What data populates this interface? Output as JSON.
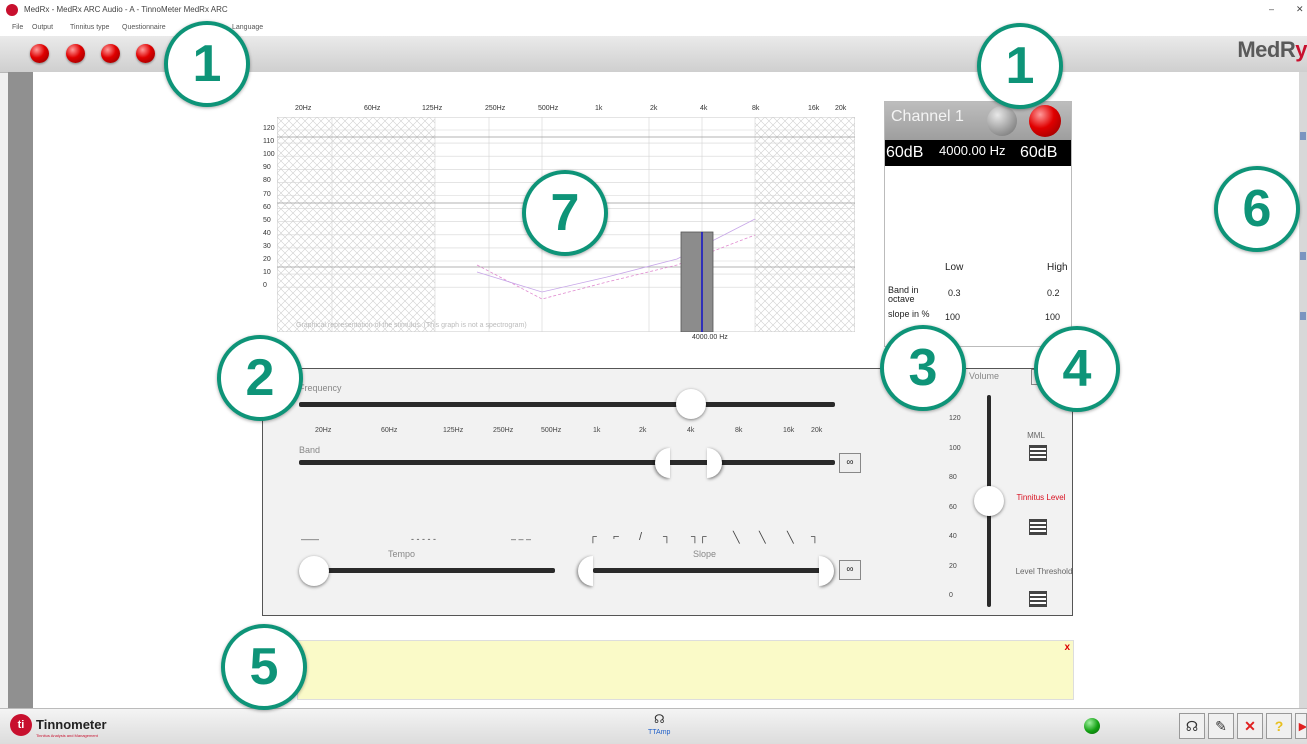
{
  "window": {
    "title": "MedRx - MedRx ARC Audio - A - TinnoMeter MedRx ARC",
    "minimize": "‒",
    "close": "✕"
  },
  "menu": [
    "File",
    "Output",
    "Tinnitus type",
    "Questionnaire",
    "Language"
  ],
  "toolbar": {
    "logo_main": "MedR",
    "logo_accent": "y"
  },
  "graph": {
    "freq_labels": [
      "20Hz",
      "60Hz",
      "125Hz",
      "250Hz",
      "500Hz",
      "1k",
      "2k",
      "4k",
      "8k",
      "16k",
      "20k"
    ],
    "db_labels": [
      "120",
      "110",
      "100",
      "90",
      "80",
      "70",
      "60",
      "50",
      "40",
      "30",
      "20",
      "10",
      "0"
    ],
    "caption": "Graphical representation of the stimulus. (This graph is not a spectrogram)",
    "marker_label": "4000.00 Hz"
  },
  "channel": {
    "title": "Channel 1",
    "left_level": "60dB",
    "frequency": "4000.00 Hz",
    "right_level": "60dB",
    "col_low": "Low",
    "col_high": "High",
    "row1_label": "Band in octave",
    "row1_low": "0.3",
    "row1_high": "0.2",
    "row2_label": "slope in %",
    "row2_low": "100",
    "row2_high": "100"
  },
  "controls": {
    "frequency_label": "Frequency",
    "freq_ticks": [
      "20Hz",
      "60Hz",
      "125Hz",
      "250Hz",
      "500Hz",
      "1k",
      "2k",
      "4k",
      "8k",
      "16k",
      "20k"
    ],
    "band_label": "Band",
    "tempo_label": "Tempo",
    "slope_label": "Slope",
    "tempo_patterns": [
      "——",
      "- - - - -",
      "– – –"
    ],
    "slope_patterns": [
      "┌",
      "⌐",
      "/",
      "┐",
      "┐┌",
      "╲",
      "╲",
      "╲",
      "┐"
    ],
    "link_icon_text": "∞",
    "volume_label": "Volume",
    "volume_ticks": [
      "120",
      "100",
      "80",
      "60",
      "40",
      "20",
      "0"
    ],
    "volume_value": 60,
    "buttons": {
      "mml": "MML",
      "tinnitus_level": "Tinnitus Level",
      "level_threshold": "Level Threshold"
    }
  },
  "message": {
    "close": "x",
    "text": ""
  },
  "statusbar": {
    "brand": "Tinnometer",
    "brand_sub": "Tinnitus Analysis and Management",
    "device": "TTAmp"
  },
  "callouts": [
    "1",
    "1",
    "7",
    "2",
    "3",
    "4",
    "5",
    "6"
  ],
  "colors": {
    "callout_green": "#0e9478",
    "led_red": "#e00000",
    "status_green": "#12a012",
    "logo_red": "#c8102e"
  }
}
